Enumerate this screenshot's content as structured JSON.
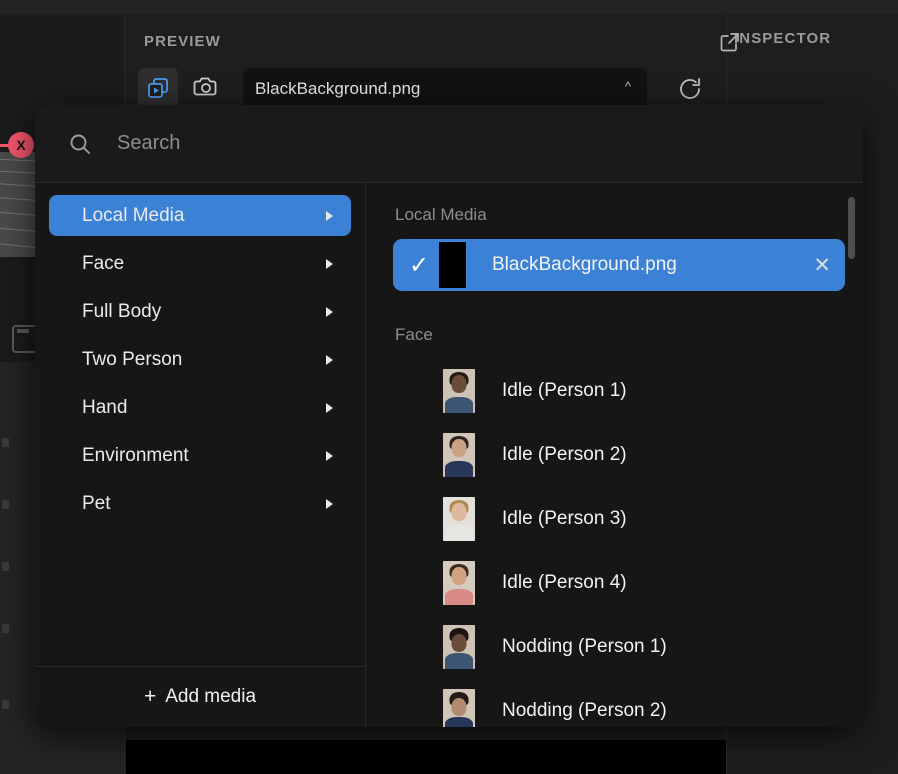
{
  "app": {
    "preview_label": "PREVIEW",
    "inspector_label": "INSPECTOR",
    "badge_label": "X"
  },
  "toolbar": {
    "layers_icon": "layers-play-icon",
    "camera_icon": "camera-icon",
    "external_link_icon": "external-link-icon",
    "refresh_icon": "refresh-icon",
    "media_value": "BlackBackground.png",
    "dropdown_caret": "^"
  },
  "modal": {
    "search_placeholder": "Search",
    "search_value": "",
    "search_icon": "search-icon",
    "sidebar": {
      "items": [
        {
          "label": "Local Media",
          "selected": true
        },
        {
          "label": "Face",
          "selected": false
        },
        {
          "label": "Full Body",
          "selected": false
        },
        {
          "label": "Two Person",
          "selected": false
        },
        {
          "label": "Hand",
          "selected": false
        },
        {
          "label": "Environment",
          "selected": false
        },
        {
          "label": "Pet",
          "selected": false
        }
      ],
      "add_media_label": "Add media",
      "add_media_plus": "+"
    },
    "results": {
      "group_local": "Local Media",
      "group_face": "Face",
      "selected_item": {
        "label": "BlackBackground.png",
        "check_glyph": "✓",
        "close_glyph": "✕",
        "thumb_color": "#000000"
      },
      "face_items": [
        {
          "label": "Idle (Person 1)",
          "bg": "#cdc3b4",
          "skin": "#6b4b39",
          "hair": "#241a16",
          "shirt": "#3b5572"
        },
        {
          "label": "Idle (Person 2)",
          "bg": "#cfc6b8",
          "skin": "#caa183",
          "hair": "#2b2320",
          "shirt": "#27365a"
        },
        {
          "label": "Idle (Person 3)",
          "bg": "#e3e0da",
          "skin": "#e0b89c",
          "hair": "#b08a55",
          "shirt": "#e8e6e2"
        },
        {
          "label": "Idle (Person 4)",
          "bg": "#d4ccbf",
          "skin": "#d2a383",
          "hair": "#3a2a20",
          "shirt": "#d98a86"
        },
        {
          "label": "Nodding (Person 1)",
          "bg": "#cdc3b4",
          "skin": "#6b4b39",
          "hair": "#1d1513",
          "shirt": "#3b5572"
        },
        {
          "label": "Nodding (Person 2)",
          "bg": "#cfc6b8",
          "skin": "#b08b6d",
          "hair": "#221b18",
          "shirt": "#27365a"
        }
      ]
    }
  },
  "colors": {
    "accent_blue": "#3b81d5",
    "badge_red": "#f4566c",
    "panel_bg": "#161616",
    "muted_text": "#8d8d8d"
  }
}
